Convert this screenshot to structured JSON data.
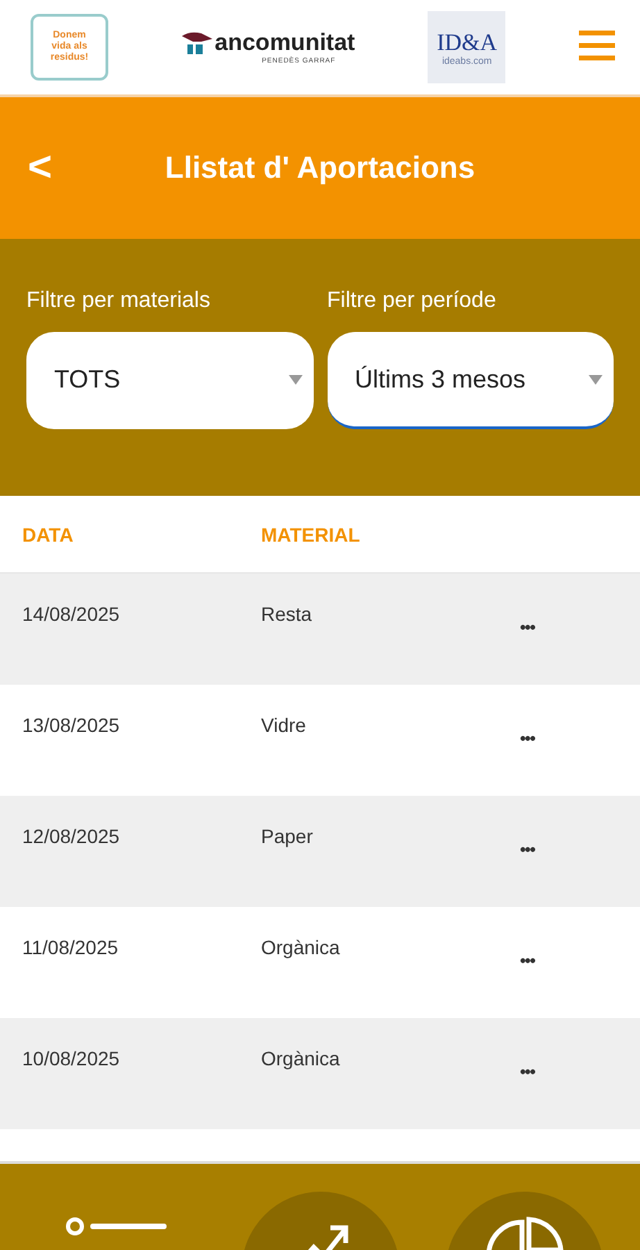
{
  "header": {
    "logo_left": [
      "Donem",
      "vida als",
      "residus!"
    ],
    "logo_center": {
      "name": "ancomunitat",
      "subtitle": "PENEDÈS GARRAF"
    },
    "logo_right": {
      "name": "ID&A",
      "url": "ideabs.com"
    }
  },
  "title_bar": {
    "back": "<",
    "title": "Llistat d' Aportacions"
  },
  "filters": [
    {
      "label": "Filtre per materials",
      "value": "TOTS",
      "selected": false
    },
    {
      "label": "Filtre per període",
      "value": "Últims 3 mesos",
      "selected": true
    }
  ],
  "table": {
    "columns": [
      "DATA",
      "MATERIAL"
    ],
    "rows": [
      {
        "date": "14/08/2025",
        "material": "Resta",
        "more": "•••"
      },
      {
        "date": "13/08/2025",
        "material": "Vidre",
        "more": "•••"
      },
      {
        "date": "12/08/2025",
        "material": "Paper",
        "more": "•••"
      },
      {
        "date": "11/08/2025",
        "material": "Orgànica",
        "more": "•••"
      },
      {
        "date": "10/08/2025",
        "material": "Orgànica",
        "more": "•••"
      }
    ]
  },
  "bottom_nav": [
    {
      "kind": "list",
      "circled": false
    },
    {
      "kind": "trend",
      "circled": true
    },
    {
      "kind": "pie",
      "circled": true
    }
  ]
}
